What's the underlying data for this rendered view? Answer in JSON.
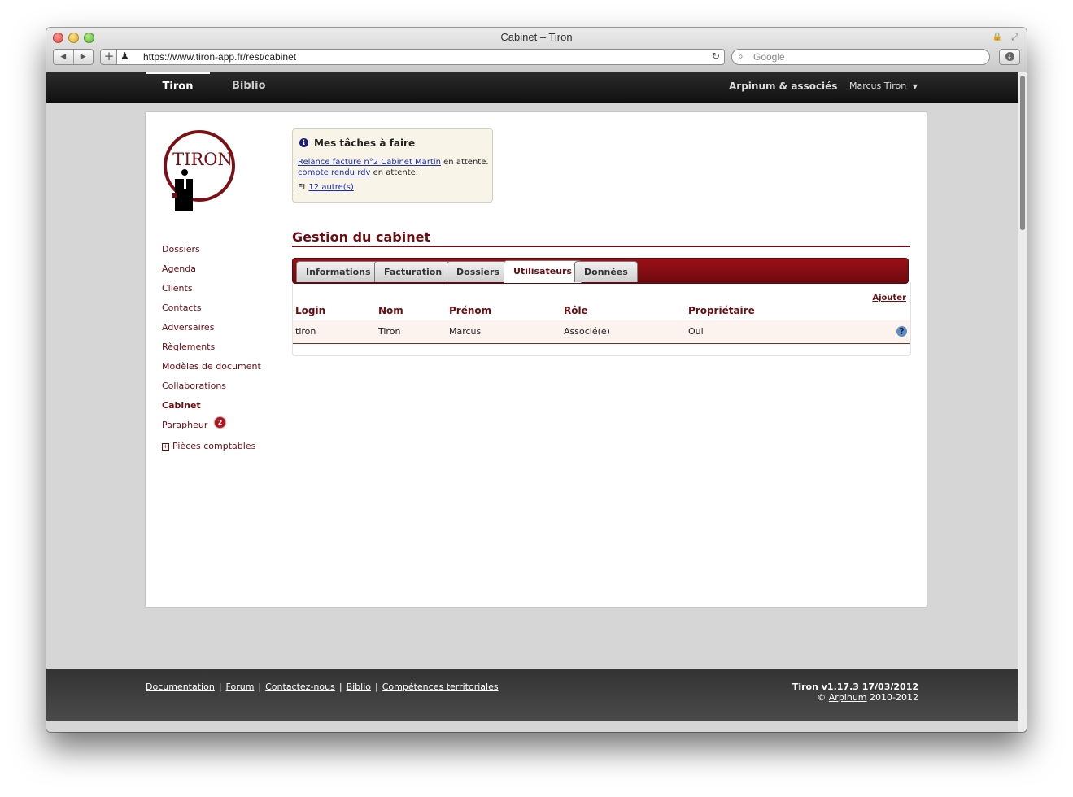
{
  "window": {
    "title": "Cabinet – Tiron"
  },
  "browser": {
    "url": "https://www.tiron-app.fr/rest/cabinet",
    "search_placeholder": "Google"
  },
  "topnav": {
    "tabs": [
      {
        "label": "Tiron"
      },
      {
        "label": "Biblio"
      }
    ],
    "firm": "Arpinum & associés",
    "user": "Marcus Tiron"
  },
  "logo": {
    "text": "TIRON"
  },
  "sidebar": {
    "items": [
      {
        "label": "Dossiers"
      },
      {
        "label": "Agenda"
      },
      {
        "label": "Clients"
      },
      {
        "label": "Contacts"
      },
      {
        "label": "Adversaires"
      },
      {
        "label": "Règlements"
      },
      {
        "label": "Modèles de document"
      },
      {
        "label": "Collaborations"
      },
      {
        "label": "Cabinet"
      },
      {
        "label": "Parapheur",
        "badge": "2"
      },
      {
        "label": "Pièces comptables"
      }
    ]
  },
  "tasks": {
    "title": "Mes tâches à faire",
    "items": [
      {
        "link": "Relance facture n°2 Cabinet Martin",
        "suffix": " en attente."
      },
      {
        "link": "compte rendu rdv",
        "suffix": " en attente."
      }
    ],
    "more_prefix": "Et ",
    "more_link": "12 autre(s)",
    "more_suffix": "."
  },
  "page": {
    "title": "Gestion du cabinet"
  },
  "tabs": [
    {
      "label": "Informations"
    },
    {
      "label": "Facturation"
    },
    {
      "label": "Dossiers"
    },
    {
      "label": "Utilisateurs"
    },
    {
      "label": "Données"
    }
  ],
  "users": {
    "add_label": "Ajouter",
    "columns": [
      "Login",
      "Nom",
      "Prénom",
      "Rôle",
      "Propriétaire"
    ],
    "rows": [
      {
        "login": "tiron",
        "nom": "Tiron",
        "prenom": "Marcus",
        "role": "Associé(e)",
        "proprietaire": "Oui"
      }
    ]
  },
  "footer": {
    "links": [
      "Documentation",
      "Forum",
      "Contactez-nous",
      "Biblio",
      "Compétences territoriales"
    ],
    "separator": "|",
    "version": "Tiron v1.17.3 17/03/2012",
    "copyright_prefix": "© ",
    "copyright_link": "Arpinum",
    "copyright_suffix": " 2010-2012"
  },
  "colors": {
    "brand": "#6b0d12",
    "tabbar": "#8a0f14",
    "topnav": "#1c1c1c",
    "footer": "#3f3f3f"
  }
}
